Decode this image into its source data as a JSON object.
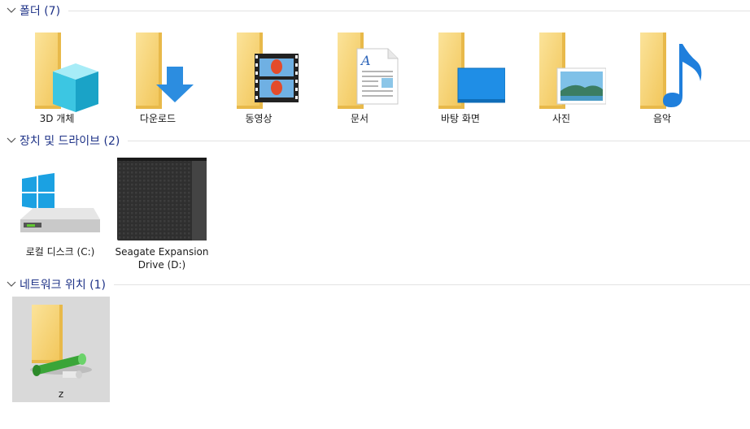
{
  "sections": {
    "folders": {
      "title": "폴더 (7)"
    },
    "devices": {
      "title": "장치 및 드라이브 (2)"
    },
    "network": {
      "title": "네트워크 위치 (1)"
    }
  },
  "folders": [
    {
      "label": "3D 개체",
      "icon": "3d-objects-folder-icon"
    },
    {
      "label": "다운로드",
      "icon": "downloads-folder-icon"
    },
    {
      "label": "동영상",
      "icon": "videos-folder-icon"
    },
    {
      "label": "문서",
      "icon": "documents-folder-icon"
    },
    {
      "label": "바탕 화면",
      "icon": "desktop-folder-icon"
    },
    {
      "label": "사진",
      "icon": "pictures-folder-icon"
    },
    {
      "label": "음악",
      "icon": "music-folder-icon"
    }
  ],
  "drives": [
    {
      "label": "로컬 디스크 (C:)",
      "icon": "local-disk-icon"
    },
    {
      "label_line1": "Seagate Expansion",
      "label_line2": "Drive (D:)",
      "icon": "external-drive-icon"
    }
  ],
  "network_locations": [
    {
      "label": "z",
      "icon": "network-folder-icon"
    }
  ],
  "colors": {
    "section_title": "#1e3287",
    "folder_yellow": "#f8d775",
    "selection_bg": "#d9d9d9"
  }
}
